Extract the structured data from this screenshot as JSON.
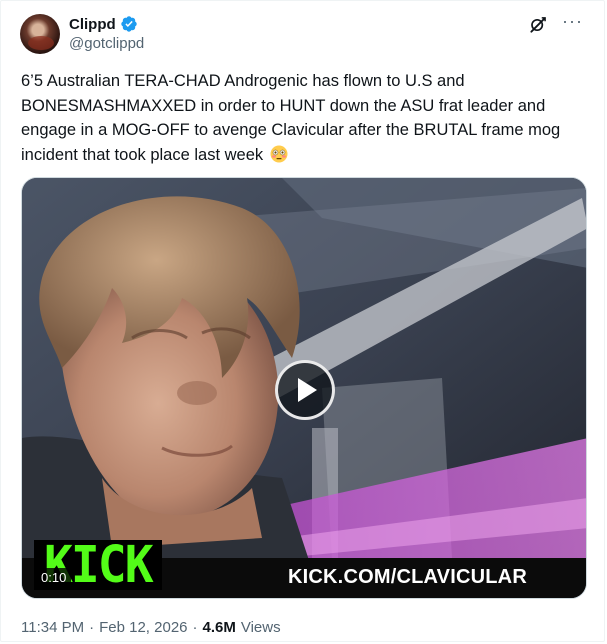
{
  "author": {
    "display_name": "Clippd",
    "handle": "@gotclippd",
    "verified": true,
    "avatar_icon": "avatar-photo"
  },
  "actions": {
    "grok_icon": "grok-icon",
    "more_icon": "more-horizontal-icon",
    "more_glyph": "···"
  },
  "tweet": {
    "text": "6’5 Australian TERA-CHAD Androgenic has flown to U.S and BONESMASHMAXXED in order to HUNT down the ASU frat leader and engage in a MOG-OFF to avenge Clavicular after the BRUTAL frame mog incident that took place last week",
    "emoji": "flushed-face"
  },
  "media": {
    "type": "video",
    "duration": "0:10",
    "overlay_logo_text": "KICK",
    "overlay_url": "KICK.COM/CLAVICULAR",
    "brand_green": "#53fc18"
  },
  "meta": {
    "time": "11:34 PM",
    "separator": "·",
    "date": "Feb 12, 2026",
    "views_count": "4.6M",
    "views_label": "Views"
  },
  "colors": {
    "text_primary": "#0f1419",
    "text_secondary": "#536471",
    "verified_blue": "#1d9bf0",
    "border": "#cfd9de"
  }
}
